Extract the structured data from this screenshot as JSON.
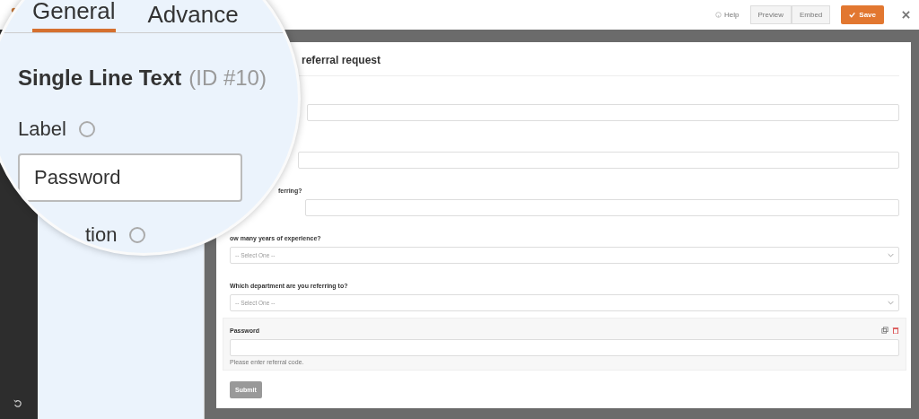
{
  "header": {
    "actions": [
      {
        "label": "Help",
        "kind": "link"
      },
      {
        "label": "Preview",
        "kind": "button"
      },
      {
        "label": "Embed",
        "kind": "button"
      }
    ],
    "save": "Save"
  },
  "magnifier": {
    "tabs": [
      {
        "label": "General",
        "selected": true
      },
      {
        "label": "Advance",
        "selected": false
      }
    ],
    "field_title": "Single Line Text",
    "field_id": "(ID #10)",
    "label_caption": "Label",
    "label_value": "Password",
    "description_caption": "tion"
  },
  "form": {
    "title": "referral request",
    "fields": [
      {
        "kind": "text",
        "selected": false
      },
      {
        "kind": "text",
        "selected": false
      },
      {
        "kind": "text",
        "label": "ferring?",
        "selected": false
      },
      {
        "kind": "select",
        "label": "ow many years of experience?",
        "placeholder": "-- Select One --",
        "selected": false
      },
      {
        "kind": "select",
        "label": "Which department are you referring to?",
        "placeholder": "-- Select One --",
        "selected": false
      },
      {
        "kind": "text",
        "label": "Password",
        "description": "Please enter referral code.",
        "selected": true
      }
    ],
    "submit": "Submit"
  }
}
